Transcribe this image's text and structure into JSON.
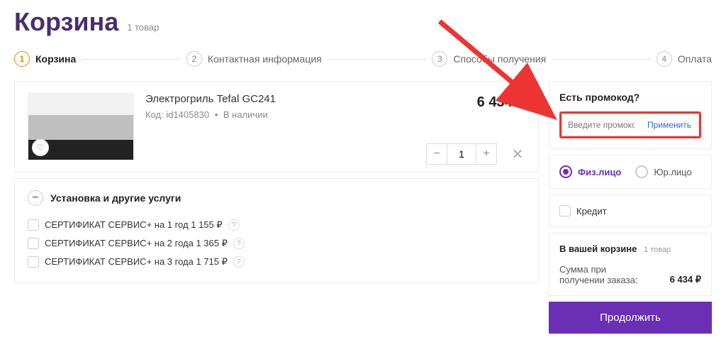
{
  "header": {
    "title": "Корзина",
    "count": "1 товар"
  },
  "stepper": {
    "s1": {
      "n": "1",
      "l": "Корзина"
    },
    "s2": {
      "n": "2",
      "l": "Контактная информация"
    },
    "s3": {
      "n": "3",
      "l": "Способы получения"
    },
    "s4": {
      "n": "4",
      "l": "Оплата"
    }
  },
  "product": {
    "name": "Электрогриль Tefal GC241",
    "code": "Код: id1405830",
    "stock": "В наличии",
    "price": "6 434 ₽",
    "qty": "1"
  },
  "services": {
    "heading": "Установка и другие услуги",
    "items": [
      "СЕРТИФИКАТ СЕРВИС+ на 1 год 1 155 ₽",
      "СЕРТИФИКАТ СЕРВИС+ на 2 года 1 365 ₽",
      "СЕРТИФИКАТ СЕРВИС+ на 3 года 1 715 ₽"
    ]
  },
  "promo": {
    "title": "Есть промокод?",
    "placeholder": "Введите промокод",
    "apply": "Применить"
  },
  "customer_type": {
    "a": "Физ.лицо",
    "b": "Юр.лицо"
  },
  "credit": {
    "label": "Кредит"
  },
  "summary": {
    "title": "В вашей корзине",
    "count": "1 товар",
    "rows": [
      {
        "l": "Сумма при получении заказа:",
        "v": "6 434 ₽"
      }
    ]
  },
  "proceed": "Продолжить"
}
